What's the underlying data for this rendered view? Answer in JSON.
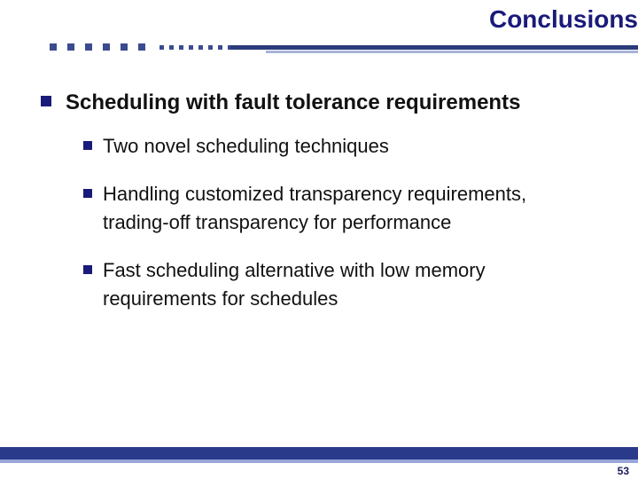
{
  "title": "Conclusions",
  "main_bullet": "Scheduling with fault tolerance requirements",
  "sub_bullets": [
    "Two novel scheduling techniques",
    "Handling customized transparency requirements, trading-off transparency for performance",
    "Fast scheduling alternative with low memory requirements for schedules"
  ],
  "slide_number": "53"
}
